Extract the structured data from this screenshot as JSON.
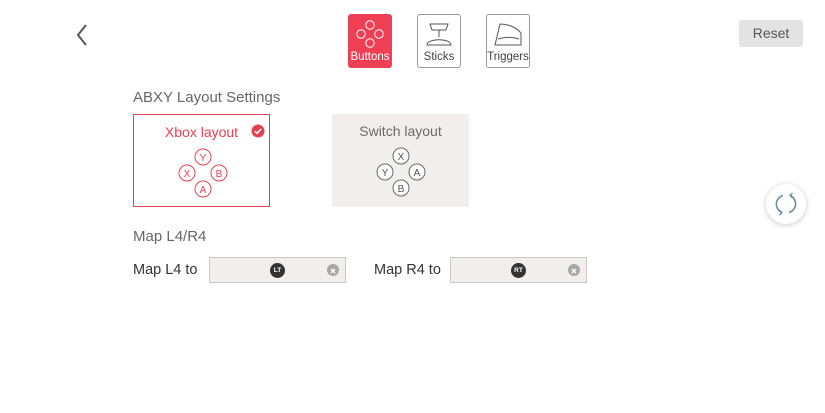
{
  "tabs": [
    {
      "label": "Buttons",
      "icon": "dpad-buttons-icon",
      "active": true
    },
    {
      "label": "Sticks",
      "icon": "joystick-icon",
      "active": false
    },
    {
      "label": "Triggers",
      "icon": "trigger-icon",
      "active": false
    }
  ],
  "reset_label": "Reset",
  "abxy": {
    "title": "ABXY Layout Settings",
    "options": [
      {
        "label": "Xbox layout",
        "selected": true,
        "buttons": {
          "top": "Y",
          "left": "X",
          "right": "B",
          "bottom": "A"
        }
      },
      {
        "label": "Switch layout",
        "selected": false,
        "buttons": {
          "top": "X",
          "left": "Y",
          "right": "A",
          "bottom": "B"
        }
      }
    ]
  },
  "map": {
    "title": "Map L4/R4",
    "l4": {
      "label": "Map L4 to",
      "value": "LT"
    },
    "r4": {
      "label": "Map R4 to",
      "value": "RT"
    }
  },
  "colors": {
    "accent": "#e9404f",
    "tab_active": "#ef3f55",
    "card_bg": "#f2eeed"
  }
}
